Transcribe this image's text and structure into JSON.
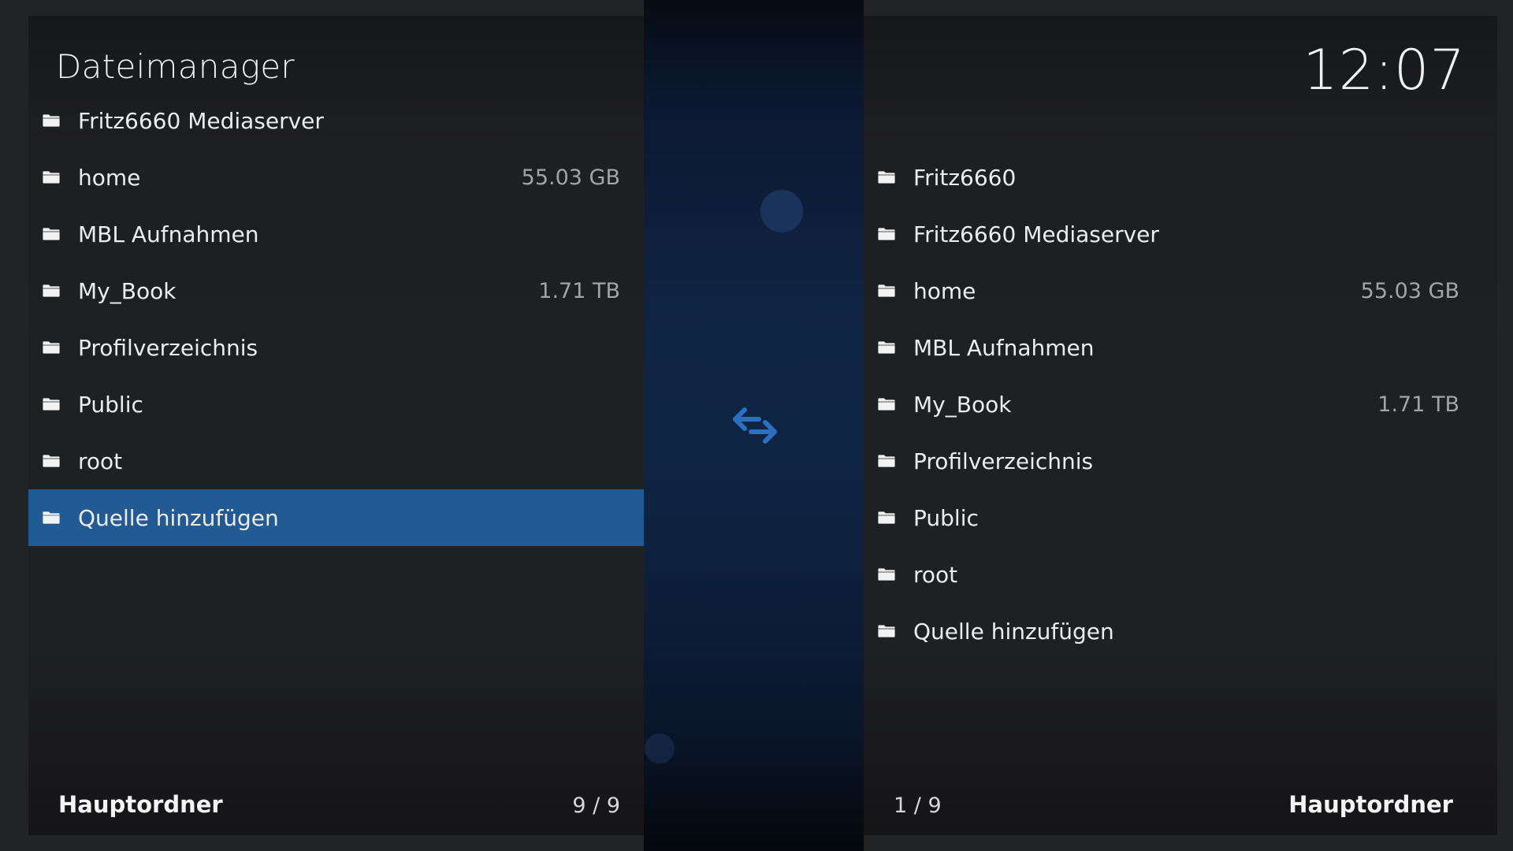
{
  "app": {
    "title": "Dateimanager",
    "clock": "12:07"
  },
  "colors": {
    "selection": "#225a94",
    "accent_icon": "#2a6fc0",
    "panel_bg": "#1e1f21",
    "center_strip": "#0f2545"
  },
  "icons": {
    "folder": "folder-icon",
    "swap": "swap-arrows-icon"
  },
  "left_panel": {
    "items": [
      {
        "label": "Fritz6660 Mediaserver",
        "size": ""
      },
      {
        "label": "home",
        "size": "55.03 GB"
      },
      {
        "label": "MBL Aufnahmen",
        "size": ""
      },
      {
        "label": "My_Book",
        "size": "1.71 TB"
      },
      {
        "label": "Profilverzeichnis",
        "size": ""
      },
      {
        "label": "Public",
        "size": ""
      },
      {
        "label": "root",
        "size": ""
      },
      {
        "label": "Quelle hinzufügen",
        "size": ""
      }
    ],
    "selected_index": 7,
    "footer_label": "Hauptordner",
    "footer_count": "9 / 9"
  },
  "right_panel": {
    "items": [
      {
        "label": "Fritz6660",
        "size": ""
      },
      {
        "label": "Fritz6660 Mediaserver",
        "size": ""
      },
      {
        "label": "home",
        "size": "55.03 GB"
      },
      {
        "label": "MBL Aufnahmen",
        "size": ""
      },
      {
        "label": "My_Book",
        "size": "1.71 TB"
      },
      {
        "label": "Profilverzeichnis",
        "size": ""
      },
      {
        "label": "Public",
        "size": ""
      },
      {
        "label": "root",
        "size": ""
      },
      {
        "label": "Quelle hinzufügen",
        "size": ""
      }
    ],
    "footer_label": "Hauptordner",
    "footer_count": "1 / 9"
  }
}
